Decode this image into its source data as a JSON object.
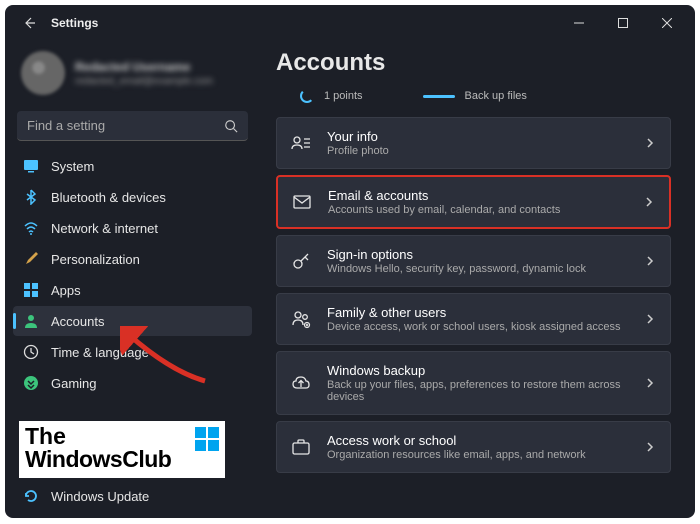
{
  "titlebar": {
    "title": "Settings"
  },
  "sidebar": {
    "user": {
      "name": "Redacted Username",
      "email": "redacted_email@example.com"
    },
    "search": {
      "placeholder": "Find a setting"
    },
    "items": [
      {
        "label": "System"
      },
      {
        "label": "Bluetooth & devices"
      },
      {
        "label": "Network & internet"
      },
      {
        "label": "Personalization"
      },
      {
        "label": "Apps"
      },
      {
        "label": "Accounts"
      },
      {
        "label": "Time & language"
      },
      {
        "label": "Gaming"
      },
      {
        "label": "Windows Update"
      }
    ]
  },
  "main": {
    "title": "Accounts",
    "stats": [
      {
        "label": "1 points"
      },
      {
        "label": "Back up files"
      }
    ],
    "cards": [
      {
        "title": "Your info",
        "sub": "Profile photo"
      },
      {
        "title": "Email & accounts",
        "sub": "Accounts used by email, calendar, and contacts"
      },
      {
        "title": "Sign-in options",
        "sub": "Windows Hello, security key, password, dynamic lock"
      },
      {
        "title": "Family & other users",
        "sub": "Device access, work or school users, kiosk assigned access"
      },
      {
        "title": "Windows backup",
        "sub": "Back up your files, apps, preferences to restore them across devices"
      },
      {
        "title": "Access work or school",
        "sub": "Organization resources like email, apps, and network"
      }
    ]
  },
  "watermark": {
    "line1": "The",
    "line2": "WindowsClub"
  }
}
